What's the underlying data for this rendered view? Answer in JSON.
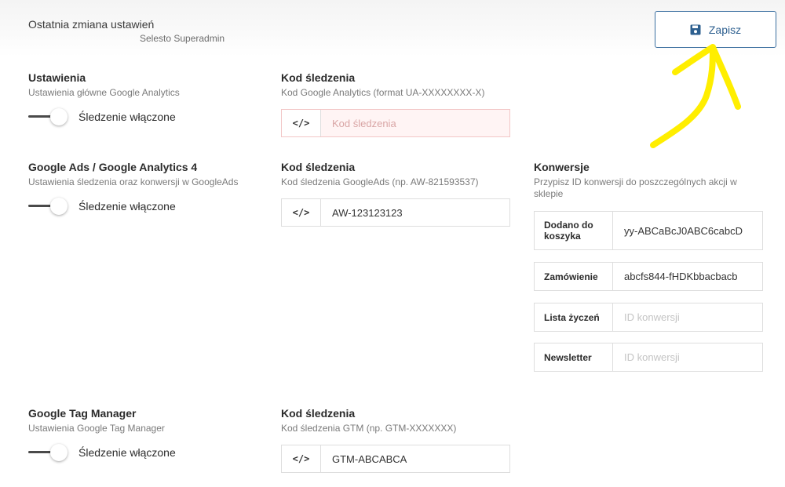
{
  "header": {
    "last_change_label": "Ostatnia zmiana ustawień",
    "last_change_user": "Selesto Superadmin",
    "save_label": "Zapisz"
  },
  "ga": {
    "title": "Ustawienia",
    "subtitle": "Ustawienia główne Google Analytics",
    "toggle_label": "Śledzenie włączone",
    "code_title": "Kod śledzenia",
    "code_subtitle": "Kod Google Analytics (format UA-XXXXXXXX-X)",
    "code_value": "",
    "code_placeholder": "Kod śledzenia"
  },
  "ads": {
    "title": "Google Ads / Google Analytics 4",
    "subtitle": "Ustawienia śledzenia oraz konwersji w GoogleAds",
    "toggle_label": "Śledzenie włączone",
    "code_title": "Kod śledzenia",
    "code_subtitle": "Kod śledzenia GoogleAds (np. AW-821593537)",
    "code_value": "AW-123123123"
  },
  "conversions": {
    "title": "Konwersje",
    "subtitle": "Przypisz ID konwersji do poszczególnych akcji w sklepie",
    "placeholder": "ID konwersji",
    "items": [
      {
        "label": "Dodano do koszyka",
        "value": "yy-ABCaBcJ0ABC6cabcD"
      },
      {
        "label": "Zamówienie",
        "value": "abcfs844-fHDKbbacbacb"
      },
      {
        "label": "Lista życzeń",
        "value": ""
      },
      {
        "label": "Newsletter",
        "value": ""
      }
    ]
  },
  "gtm": {
    "title": "Google Tag Manager",
    "subtitle": "Ustawienia Google Tag Manager",
    "toggle_label": "Śledzenie włączone",
    "code_title": "Kod śledzenia",
    "code_subtitle": "Kod śledzenia GTM (np. GTM-XXXXXXX)",
    "code_value": "GTM-ABCABCA"
  },
  "code_icon_glyph": "</>",
  "colors": {
    "accent": "#2d5f8f",
    "annotation_arrow": "#ffee00",
    "error_border": "#f2c6c6"
  }
}
